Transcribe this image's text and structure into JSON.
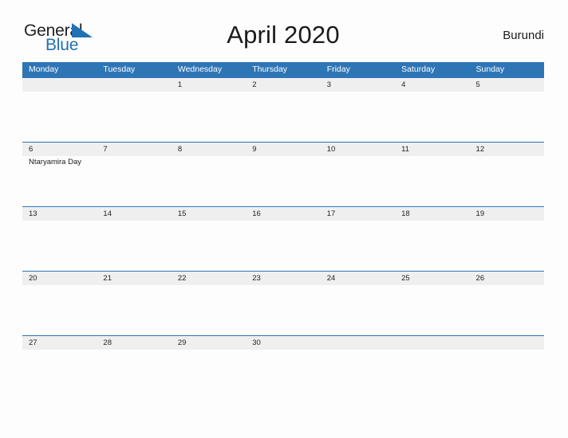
{
  "brand": {
    "name_part1": "General",
    "name_part2": "Blue",
    "flag_icon": "blue-triangle-flag-icon",
    "color_dark": "#231f20",
    "color_blue": "#2171b5"
  },
  "header": {
    "title": "April 2020",
    "country": "Burundi"
  },
  "theme": {
    "header_blue": "#2e75b6",
    "row_band_gray": "#efefef",
    "page_background": "#fdfdfd",
    "text_dark": "#222222"
  },
  "calendar": {
    "month": "April",
    "year": "2020",
    "weekday_headers": [
      "Monday",
      "Tuesday",
      "Wednesday",
      "Thursday",
      "Friday",
      "Saturday",
      "Sunday"
    ],
    "weeks": [
      [
        {
          "day": "",
          "events": []
        },
        {
          "day": "",
          "events": []
        },
        {
          "day": "1",
          "events": []
        },
        {
          "day": "2",
          "events": []
        },
        {
          "day": "3",
          "events": []
        },
        {
          "day": "4",
          "events": []
        },
        {
          "day": "5",
          "events": []
        }
      ],
      [
        {
          "day": "6",
          "events": [
            "Ntaryamira Day"
          ]
        },
        {
          "day": "7",
          "events": []
        },
        {
          "day": "8",
          "events": []
        },
        {
          "day": "9",
          "events": []
        },
        {
          "day": "10",
          "events": []
        },
        {
          "day": "11",
          "events": []
        },
        {
          "day": "12",
          "events": []
        }
      ],
      [
        {
          "day": "13",
          "events": []
        },
        {
          "day": "14",
          "events": []
        },
        {
          "day": "15",
          "events": []
        },
        {
          "day": "16",
          "events": []
        },
        {
          "day": "17",
          "events": []
        },
        {
          "day": "18",
          "events": []
        },
        {
          "day": "19",
          "events": []
        }
      ],
      [
        {
          "day": "20",
          "events": []
        },
        {
          "day": "21",
          "events": []
        },
        {
          "day": "22",
          "events": []
        },
        {
          "day": "23",
          "events": []
        },
        {
          "day": "24",
          "events": []
        },
        {
          "day": "25",
          "events": []
        },
        {
          "day": "26",
          "events": []
        }
      ],
      [
        {
          "day": "27",
          "events": []
        },
        {
          "day": "28",
          "events": []
        },
        {
          "day": "29",
          "events": []
        },
        {
          "day": "30",
          "events": []
        },
        {
          "day": "",
          "events": []
        },
        {
          "day": "",
          "events": []
        },
        {
          "day": "",
          "events": []
        }
      ]
    ]
  }
}
